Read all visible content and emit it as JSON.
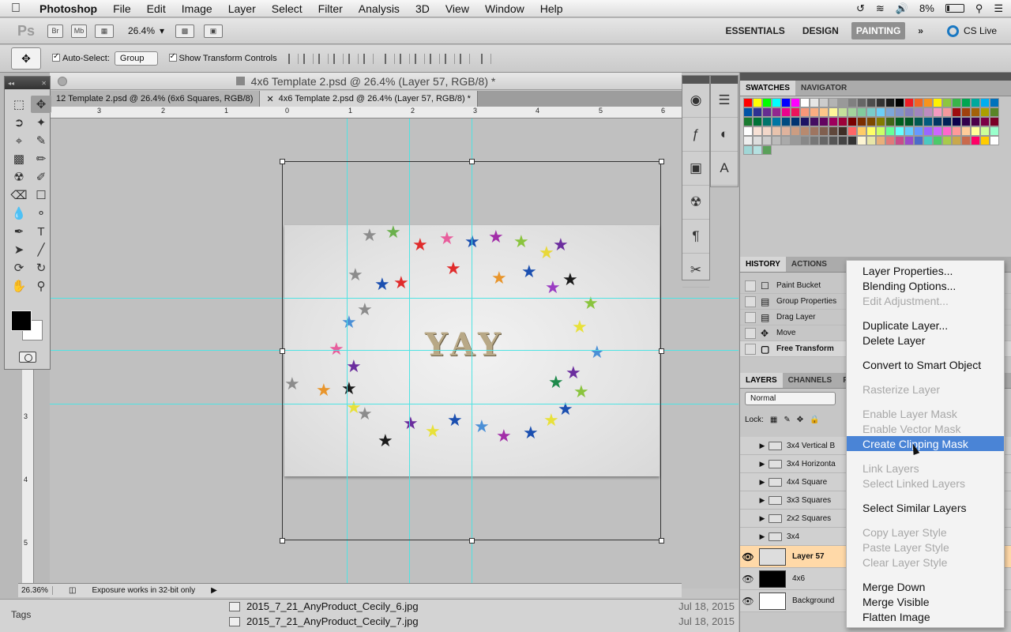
{
  "menubar": {
    "app_name": "Photoshop",
    "items": [
      "File",
      "Edit",
      "Image",
      "Layer",
      "Select",
      "Filter",
      "Analysis",
      "3D",
      "View",
      "Window",
      "Help"
    ],
    "battery": "8%"
  },
  "appbar": {
    "ps": "Ps",
    "br": "Br",
    "mb": "Mb",
    "zoom": "26.4%",
    "workspaces": [
      "ESSENTIALS",
      "DESIGN",
      "PAINTING"
    ],
    "active_workspace": "PAINTING",
    "more": "»",
    "cs_live": "CS Live"
  },
  "options": {
    "auto_select_label": "Auto-Select:",
    "auto_select_value": "Group",
    "transform_controls_label": "Show Transform Controls"
  },
  "document": {
    "window_title": "4x6 Template 2.psd @ 26.4% (Layer 57, RGB/8) *",
    "tabs": [
      "12 Template 2.psd @ 26.4% (6x6 Squares, RGB/8)",
      "4x6 Template 2.psd @ 26.4% (Layer 57, RGB/8) *"
    ],
    "ruler_top": [
      "3",
      "2",
      "1",
      "0",
      "1",
      "2",
      "3",
      "4",
      "5",
      "6"
    ],
    "ruler_left": [
      "3",
      "4",
      "5"
    ],
    "image_text": "YAY",
    "status_zoom": "26.36%",
    "status_text": "Exposure works in 32-bit only"
  },
  "filestrip": {
    "tags": "Tags",
    "files": [
      {
        "name": "2015_7_21_AnyProduct_Cecily_6.jpg",
        "date": "Jul 18, 2015"
      },
      {
        "name": "2015_7_21_AnyProduct_Cecily_7.jpg",
        "date": "Jul 18, 2015"
      }
    ]
  },
  "panels": {
    "swatch_tabs": [
      "SWATCHES",
      "NAVIGATOR"
    ],
    "history_tabs": [
      "HISTORY",
      "ACTIONS"
    ],
    "history_items": [
      "Paint Bucket",
      "Group Properties",
      "Drag Layer",
      "Move",
      "Free Transform"
    ],
    "layer_tabs": [
      "LAYERS",
      "CHANNELS",
      "PAT"
    ],
    "blend_mode": "Normal",
    "lock_label": "Lock:",
    "layers": [
      {
        "name": "3x4 Vertical B",
        "type": "group"
      },
      {
        "name": "3x4 Horizonta",
        "type": "group"
      },
      {
        "name": "4x4 Square",
        "type": "group"
      },
      {
        "name": "3x3 Squares",
        "type": "group"
      },
      {
        "name": "2x2 Squares",
        "type": "group"
      },
      {
        "name": "3x4",
        "type": "group"
      },
      {
        "name": "Layer 57",
        "type": "image"
      },
      {
        "name": "4x6",
        "type": "fill-black"
      },
      {
        "name": "Background",
        "type": "fill-white"
      }
    ]
  },
  "context_menu": {
    "groups": [
      [
        {
          "label": "Layer Properties...",
          "enabled": true
        },
        {
          "label": "Blending Options...",
          "enabled": true
        },
        {
          "label": "Edit Adjustment...",
          "enabled": false
        }
      ],
      [
        {
          "label": "Duplicate Layer...",
          "enabled": true
        },
        {
          "label": "Delete Layer",
          "enabled": true
        }
      ],
      [
        {
          "label": "Convert to Smart Object",
          "enabled": true
        }
      ],
      [
        {
          "label": "Rasterize Layer",
          "enabled": false
        }
      ],
      [
        {
          "label": "Enable Layer Mask",
          "enabled": false
        },
        {
          "label": "Enable Vector Mask",
          "enabled": false
        },
        {
          "label": "Create Clipping Mask",
          "enabled": true,
          "hover": true
        }
      ],
      [
        {
          "label": "Link Layers",
          "enabled": false
        },
        {
          "label": "Select Linked Layers",
          "enabled": false
        }
      ],
      [
        {
          "label": "Select Similar Layers",
          "enabled": true
        }
      ],
      [
        {
          "label": "Copy Layer Style",
          "enabled": false
        },
        {
          "label": "Paste Layer Style",
          "enabled": false
        },
        {
          "label": "Clear Layer Style",
          "enabled": false
        }
      ],
      [
        {
          "label": "Merge Down",
          "enabled": true
        },
        {
          "label": "Merge Visible",
          "enabled": true
        },
        {
          "label": "Flatten Image",
          "enabled": true
        }
      ]
    ]
  },
  "colors": {
    "guide": "#4fe3e3",
    "highlight": "#4a84d6",
    "active_layer": "#ffd9a8"
  }
}
